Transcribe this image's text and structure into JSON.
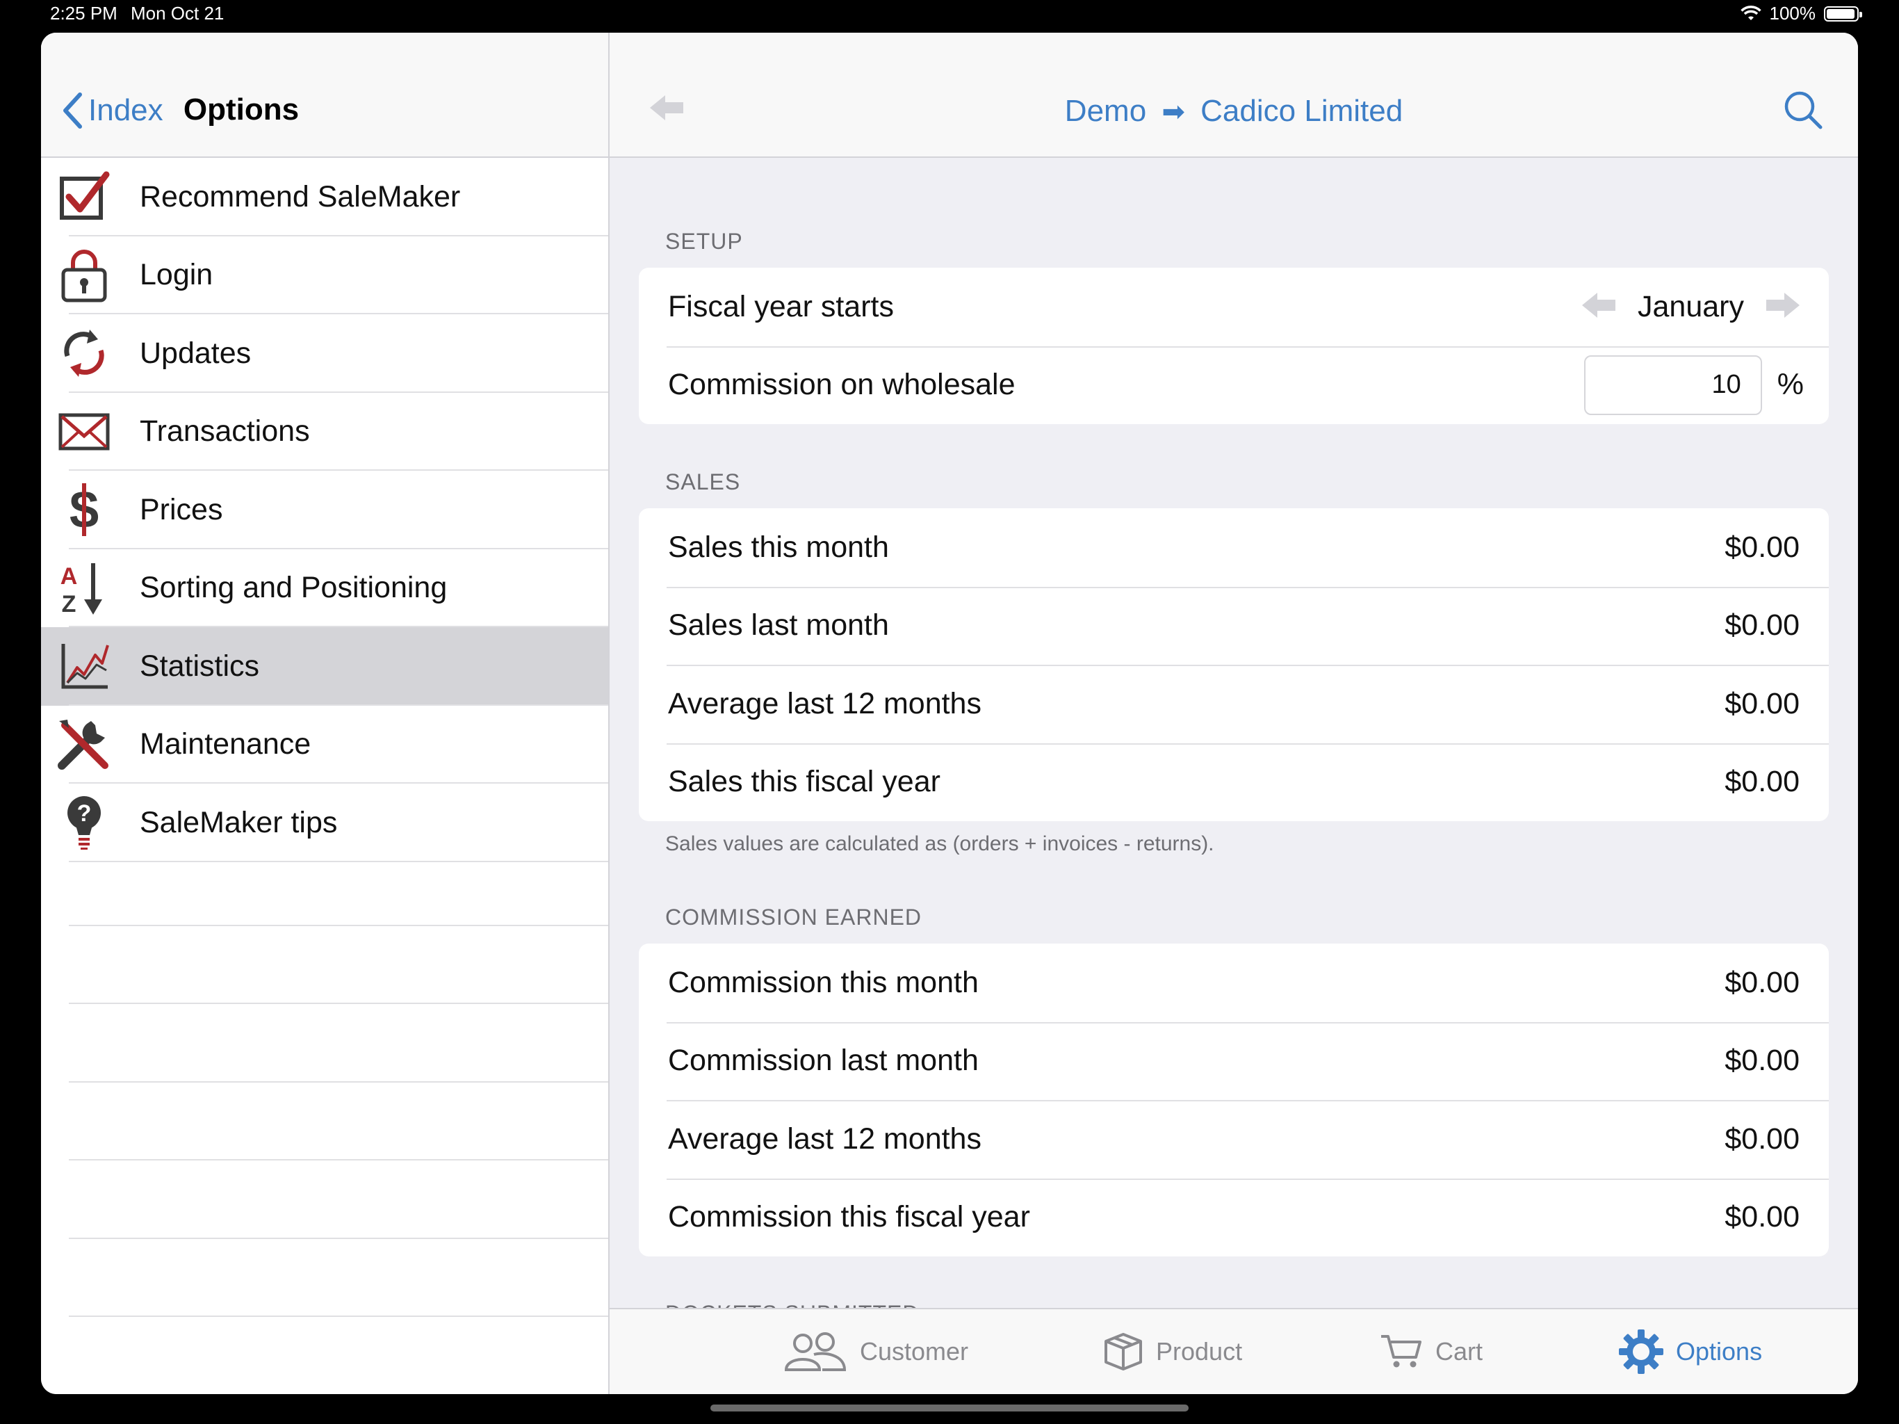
{
  "status_bar": {
    "time": "2:25 PM",
    "date": "Mon Oct 21",
    "battery": "100%"
  },
  "sidebar": {
    "back_label": "Index",
    "title": "Options",
    "items": [
      {
        "label": "Recommend SaleMaker",
        "icon": "checkbox-icon"
      },
      {
        "label": "Login",
        "icon": "lock-icon"
      },
      {
        "label": "Updates",
        "icon": "refresh-icon"
      },
      {
        "label": "Transactions",
        "icon": "envelope-icon"
      },
      {
        "label": "Prices",
        "icon": "dollar-icon"
      },
      {
        "label": "Sorting and Positioning",
        "icon": "sort-az-icon"
      },
      {
        "label": "Statistics",
        "icon": "chart-icon",
        "selected": true
      },
      {
        "label": "Maintenance",
        "icon": "tools-icon"
      },
      {
        "label": "SaleMaker tips",
        "icon": "lightbulb-question-icon"
      }
    ]
  },
  "header": {
    "crumb_from": "Demo",
    "crumb_arrow": "➡",
    "crumb_to": "Cadico Limited"
  },
  "setup": {
    "heading": "SETUP",
    "fiscal_label": "Fiscal year starts",
    "fiscal_value": "January",
    "commission_label": "Commission on wholesale",
    "commission_value": "10",
    "commission_unit": "%"
  },
  "sales": {
    "heading": "SALES",
    "rows": [
      {
        "label": "Sales this month",
        "value": "$0.00"
      },
      {
        "label": "Sales last month",
        "value": "$0.00"
      },
      {
        "label": "Average last 12 months",
        "value": "$0.00"
      },
      {
        "label": "Sales this fiscal year",
        "value": "$0.00"
      }
    ],
    "footnote": "Sales values are calculated as (orders + invoices - returns)."
  },
  "commission": {
    "heading": "COMMISSION EARNED",
    "rows": [
      {
        "label": "Commission this month",
        "value": "$0.00"
      },
      {
        "label": "Commission last month",
        "value": "$0.00"
      },
      {
        "label": "Average last 12 months",
        "value": "$0.00"
      },
      {
        "label": "Commission this fiscal year",
        "value": "$0.00"
      }
    ]
  },
  "dockets": {
    "heading": "DOCKETS SUBMITTED"
  },
  "tabbar": {
    "tabs": [
      {
        "label": "Customer",
        "icon": "customers-icon"
      },
      {
        "label": "Product",
        "icon": "box-icon"
      },
      {
        "label": "Cart",
        "icon": "cart-icon"
      },
      {
        "label": "Options",
        "icon": "gear-icon",
        "active": true
      }
    ]
  },
  "colors": {
    "accent": "#3d7ec6",
    "icon_red": "#b0282c",
    "icon_dark": "#3a3a3a",
    "selected_row": "#d4d4d8"
  }
}
